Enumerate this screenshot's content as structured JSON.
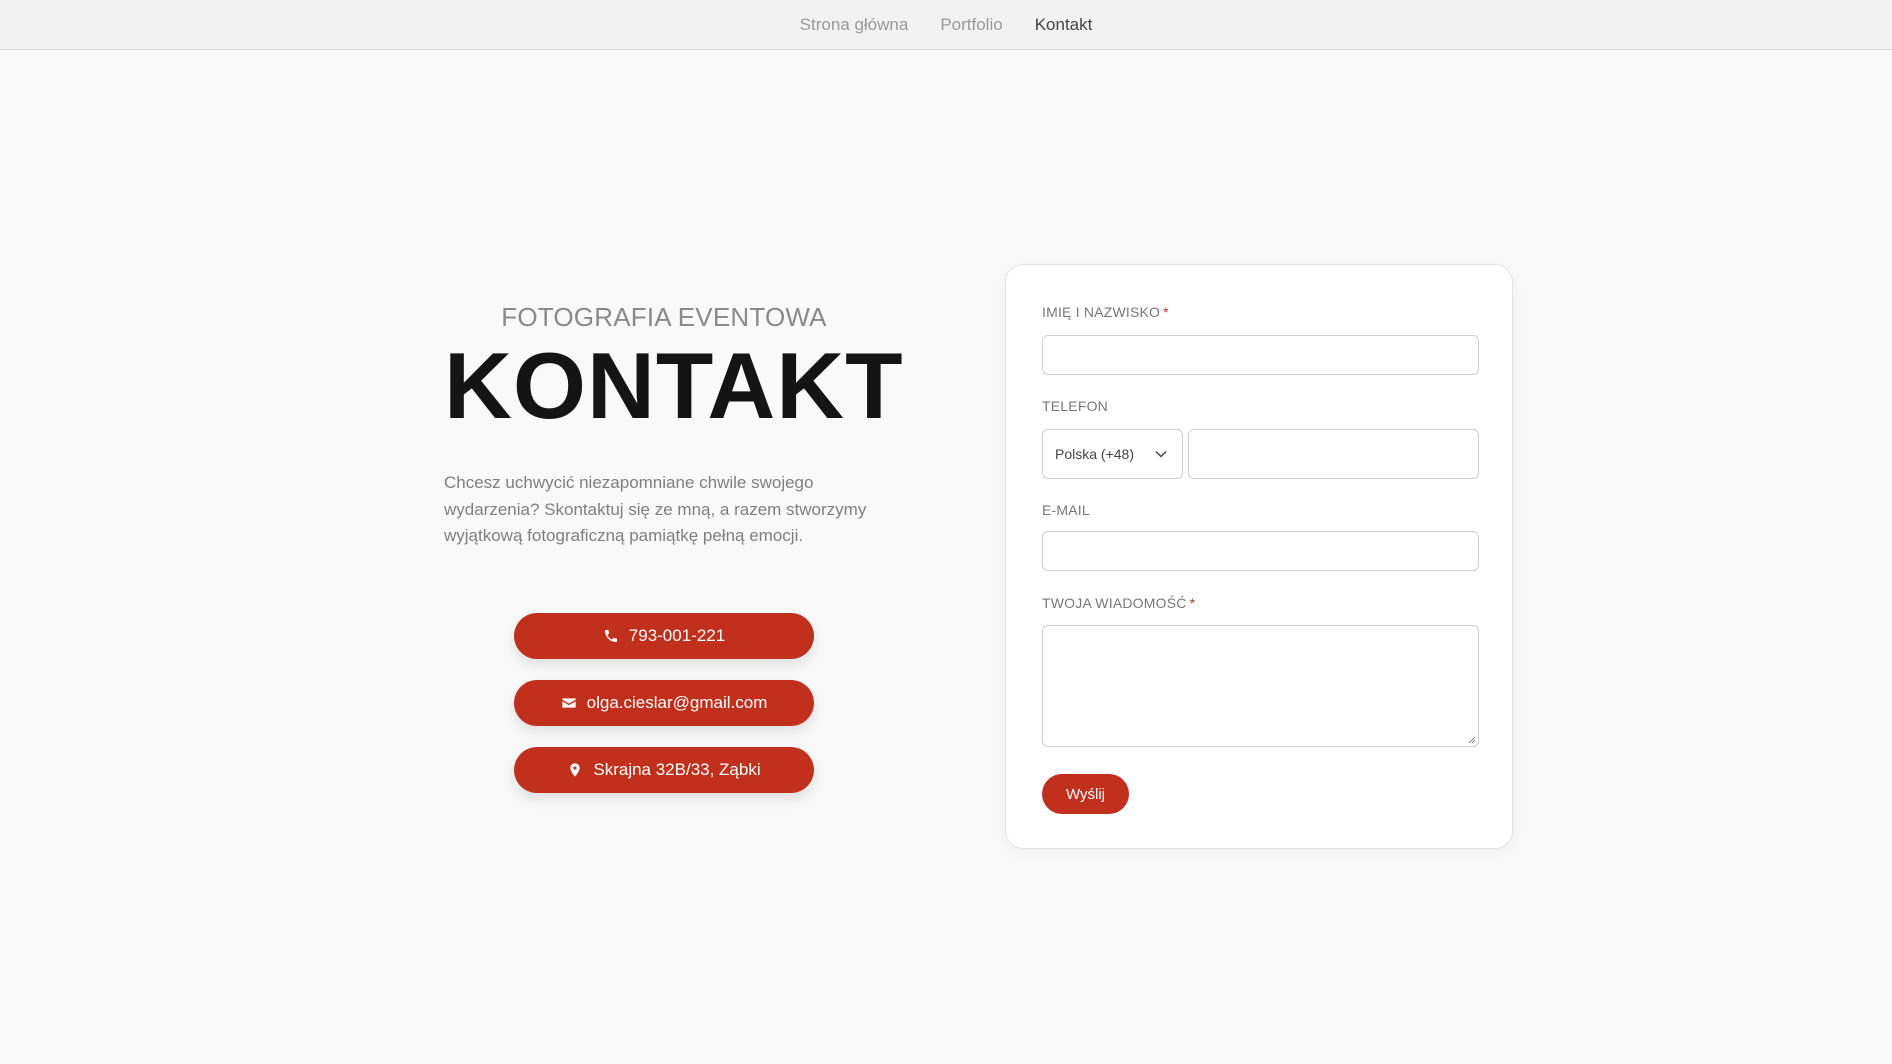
{
  "nav": {
    "items": [
      {
        "label": "Strona główna"
      },
      {
        "label": "Portfolio"
      },
      {
        "label": "Kontakt"
      }
    ]
  },
  "hero": {
    "eyebrow": "FOTOGRAFIA EVENTOWA",
    "title": "KONTAKT",
    "intro": "Chcesz uchwycić niezapomniane chwile swojego wydarzenia? Skontaktuj się ze mną, a razem stworzymy wyjątkową fotograficzną pamiątkę pełną emocji."
  },
  "contacts": {
    "phone": {
      "label": "793-001-221",
      "icon": "phone-icon"
    },
    "email": {
      "label": "olga.cieslar@gmail.com",
      "icon": "envelope-icon"
    },
    "address": {
      "label": "Skrajna 32B/33, Ząbki",
      "icon": "map-pin-icon"
    }
  },
  "form": {
    "name_label": "IMIĘ I NAZWISKO",
    "phone_label": "TELEFON",
    "country_selected": "Polska (+48)",
    "email_label": "E-MAIL",
    "message_label": "TWOJA WIADOMOŚĆ",
    "required_mark": "*",
    "submit_label": "Wyślij"
  },
  "colors": {
    "accent": "#c0301c",
    "background": "#f9f9f9",
    "heading": "#141414"
  }
}
